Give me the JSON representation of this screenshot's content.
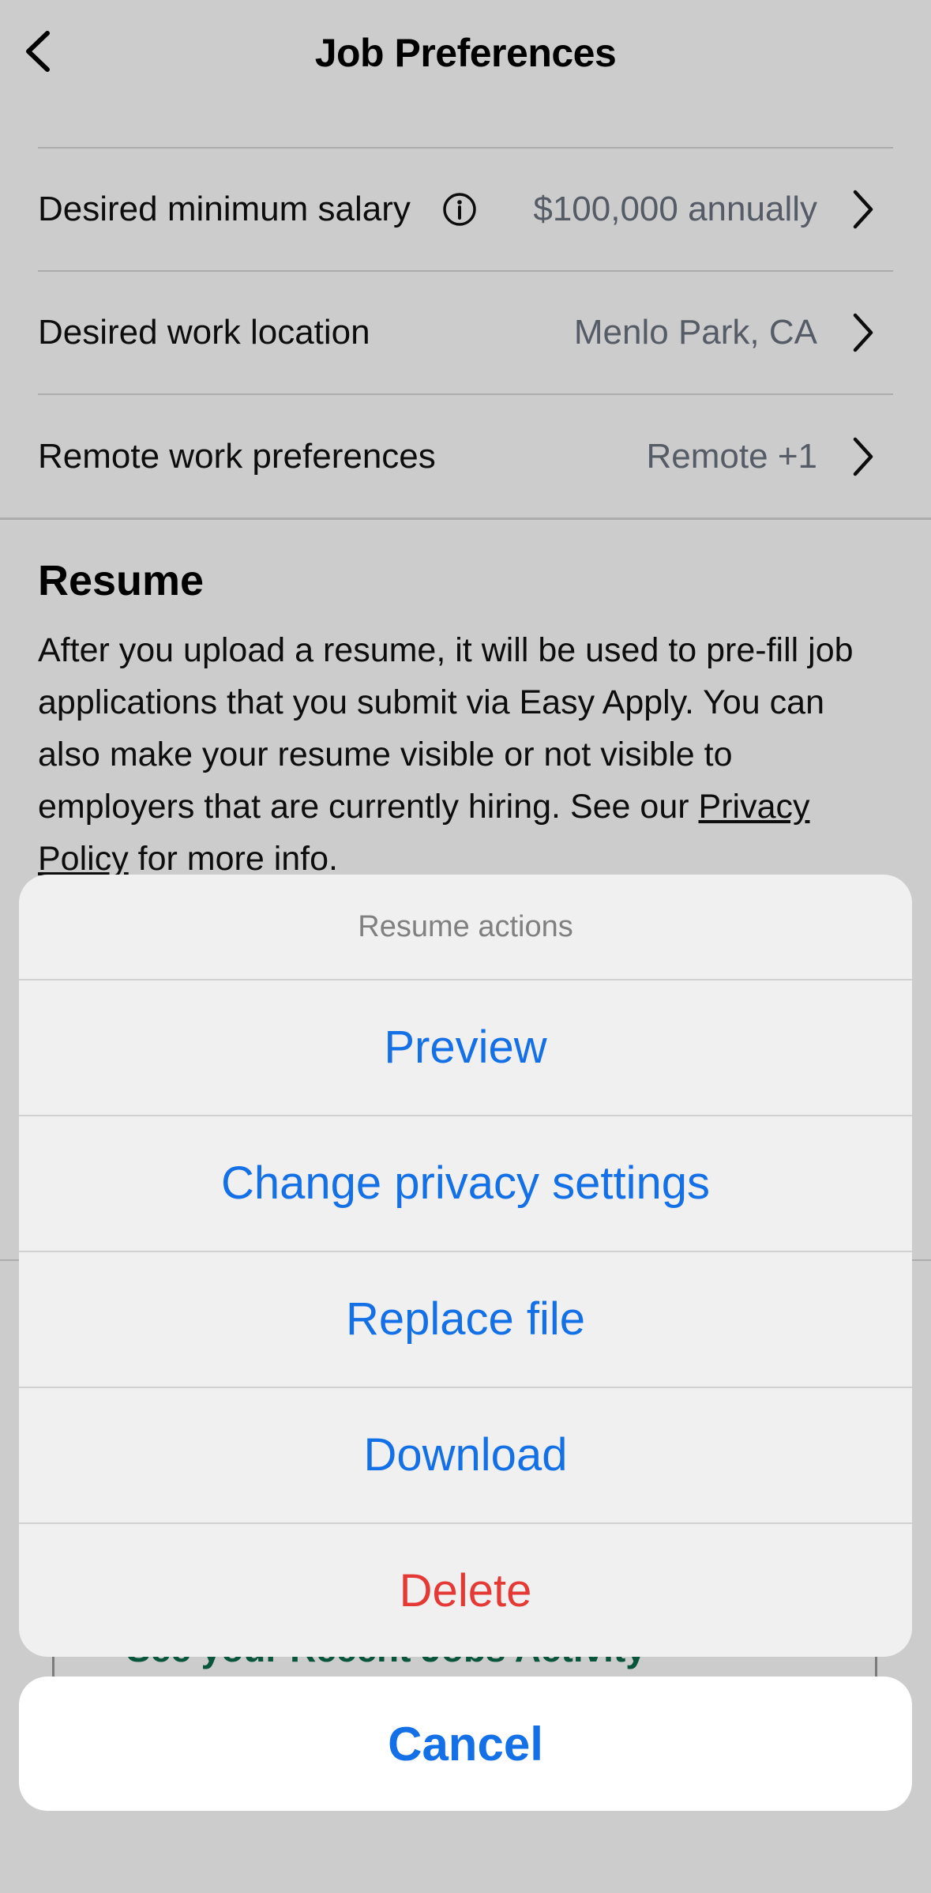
{
  "header": {
    "title": "Job Preferences",
    "back_icon": "chevron-left-icon"
  },
  "preferences": [
    {
      "label": "Desired minimum salary",
      "value": "$100,000 annually",
      "has_info": true
    },
    {
      "label": "Desired work location",
      "value": "Menlo Park, CA",
      "has_info": false
    },
    {
      "label": "Remote work preferences",
      "value": "Remote +1",
      "has_info": false
    }
  ],
  "resume": {
    "heading": "Resume",
    "description": "After you upload a resume, it will be used to pre-fill job applications that you submit via Easy Apply. You can also make your resume visible or not visible to employers that are currently hiring. See our ",
    "privacy_link": "Privacy Policy",
    "description_end": " for more info."
  },
  "lower": {
    "recent_jobs_link": "See your Recent Jobs Activity"
  },
  "action_sheet": {
    "title": "Resume actions",
    "items": [
      "Preview",
      "Change privacy settings",
      "Replace file",
      "Download",
      "Delete"
    ],
    "cancel": "Cancel"
  },
  "colors": {
    "action_blue": "#1470e6",
    "destructive_red": "#e53935",
    "link_green": "#0a6b4a"
  }
}
